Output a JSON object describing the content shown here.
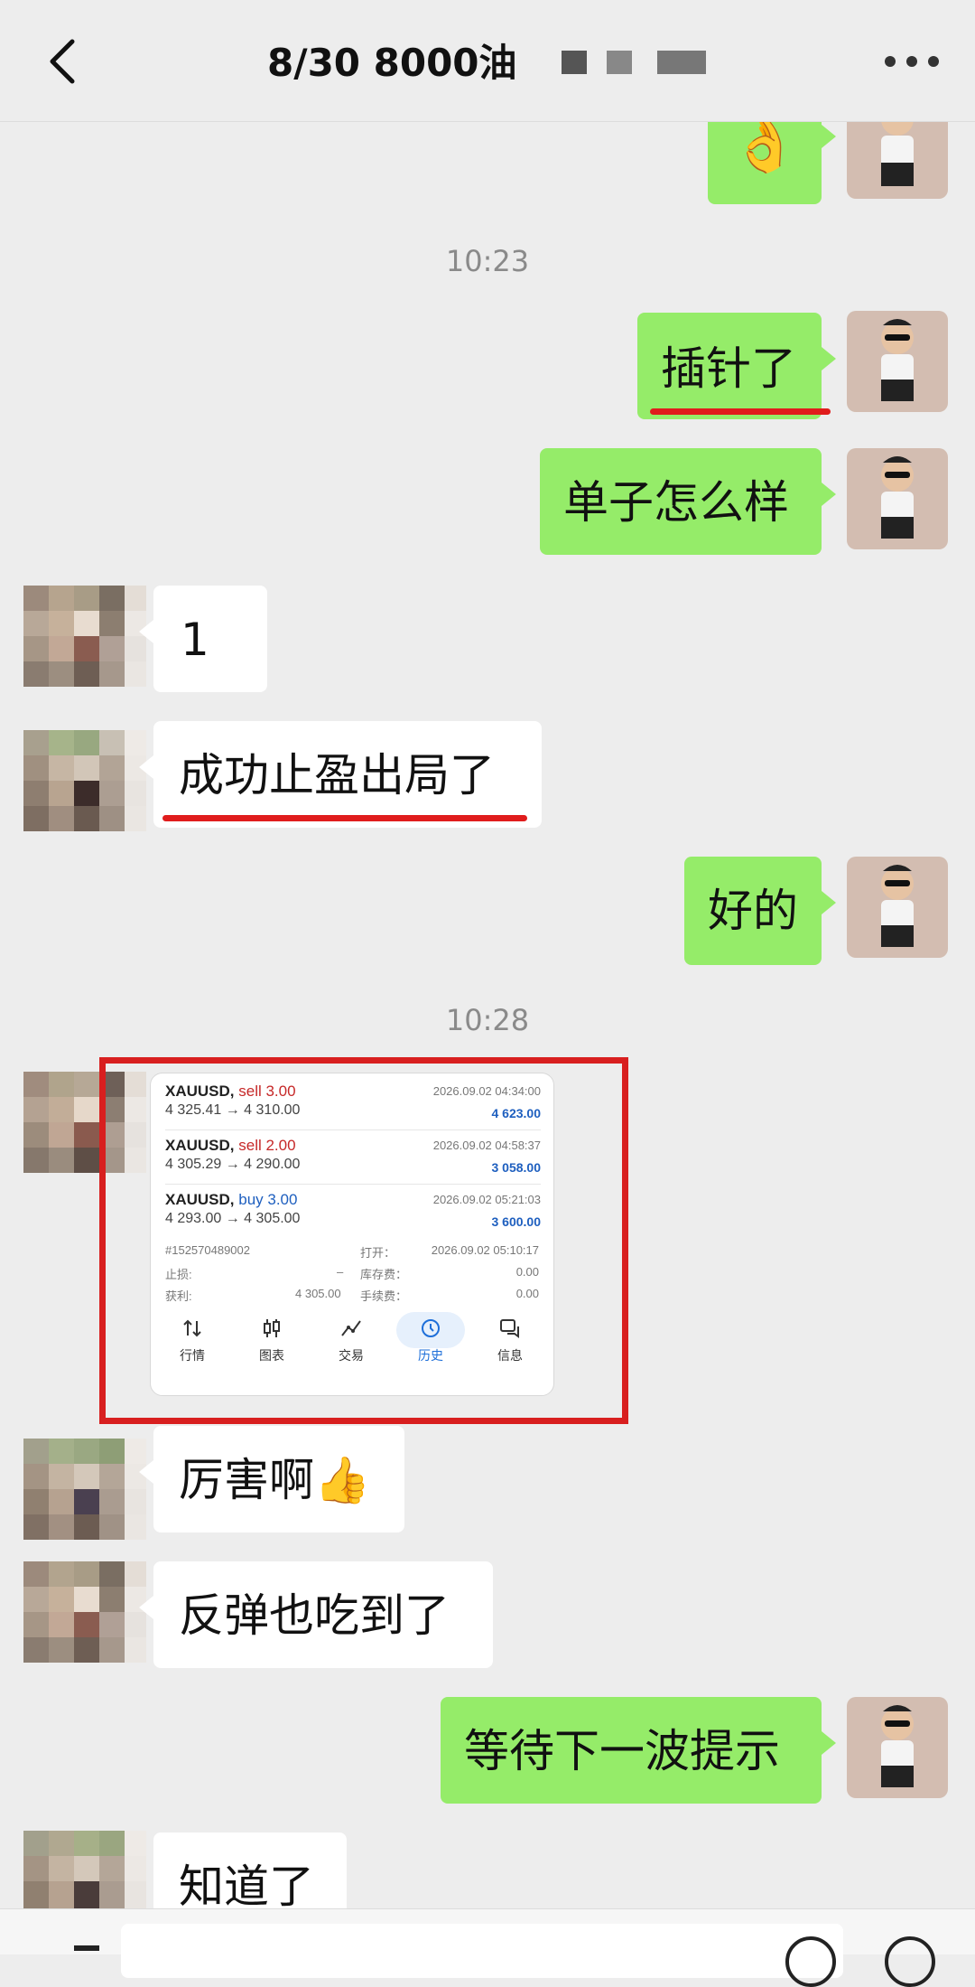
{
  "header": {
    "title": "8/30  8000油"
  },
  "chat": {
    "msg_ok": {
      "text": "👌"
    },
    "ts1": "10:23",
    "msg1": {
      "text": "插针了"
    },
    "msg2": {
      "text": "单子怎么样"
    },
    "msg3": {
      "text": "1"
    },
    "msg4": {
      "text": "成功止盈出局了"
    },
    "msg5": {
      "text": "好的"
    },
    "ts2": "10:28",
    "msg7": {
      "text": "厉害啊👍"
    },
    "msg8": {
      "text": "反弹也吃到了"
    },
    "msg9": {
      "text": "等待下一波提示"
    },
    "msg10": {
      "text": "知道了"
    }
  },
  "trade_card": {
    "trades": [
      {
        "symbol": "XAUUSD,",
        "side": "sell 3.00",
        "prices": "4 325.41 → 4 310.00",
        "datetime": "2026.09.02 04:34:00",
        "profit": "4 623.00"
      },
      {
        "symbol": "XAUUSD,",
        "side": "sell 2.00",
        "prices": "4 305.29 → 4 290.00",
        "datetime": "2026.09.02 04:58:37",
        "profit": "3 058.00"
      },
      {
        "symbol": "XAUUSD,",
        "side": "buy 3.00",
        "prices": "4 293.00 → 4 305.00",
        "datetime": "2026.09.02 05:21:03",
        "profit": "3 600.00"
      }
    ],
    "details": {
      "order_id": "#152570489002",
      "open_label": "打开：",
      "open_value": "2026.09.02 05:10:17",
      "sl_label": "止损:",
      "sl_value": "–",
      "swap_label": "库存费：",
      "swap_value": "0.00",
      "tp_label": "获利:",
      "tp_value": "4 305.00",
      "fee_label": "手续费：",
      "fee_value": "0.00"
    },
    "nav": [
      {
        "label": "行情",
        "icon": "arrows-updown-icon",
        "active": false
      },
      {
        "label": "图表",
        "icon": "candlestick-icon",
        "active": false
      },
      {
        "label": "交易",
        "icon": "trade-line-icon",
        "active": false
      },
      {
        "label": "历史",
        "icon": "history-clock-icon",
        "active": true
      },
      {
        "label": "信息",
        "icon": "message-icon",
        "active": false
      }
    ]
  },
  "colors": {
    "my_bubble": "#95ec69",
    "their_bubble": "#ffffff",
    "background": "#ededed",
    "highlight": "#d81f1f"
  }
}
